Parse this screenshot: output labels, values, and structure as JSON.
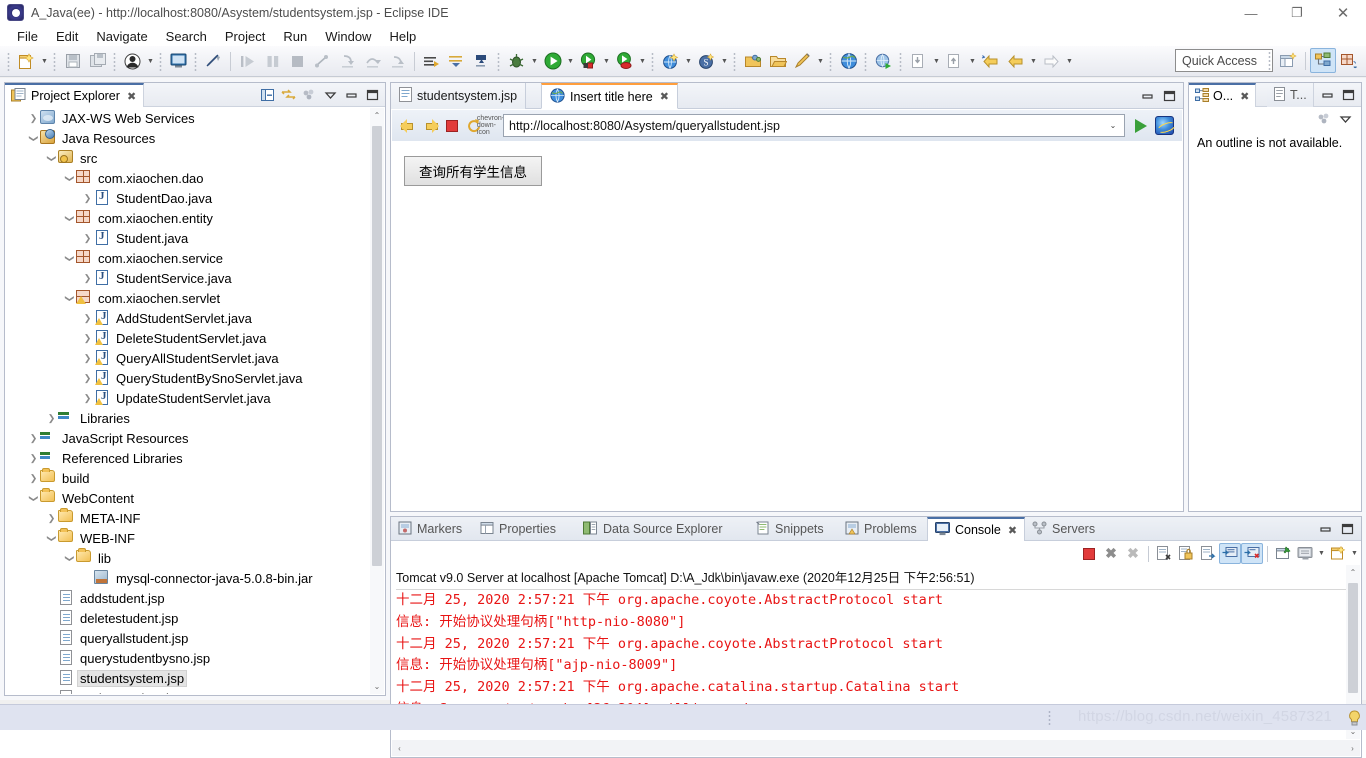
{
  "window": {
    "title": "A_Java(ee) - http://localhost:8080/Asystem/studentsystem.jsp - Eclipse IDE",
    "minimize": "—",
    "maximize": "❐",
    "close": "✕"
  },
  "menubar": {
    "items": [
      "File",
      "Edit",
      "Navigate",
      "Search",
      "Project",
      "Run",
      "Window",
      "Help"
    ]
  },
  "toolbar": {
    "quick_access_placeholder": "Quick Access",
    "perspective_buttons": [
      "open-perspective-icon",
      "java-ee-perspective-icon",
      "java-perspective-icon"
    ]
  },
  "project_explorer": {
    "tab_label": "Project Explorer",
    "tab_close": "✖",
    "tools": [
      "collapse-all-icon",
      "link-with-editor-icon",
      "view-menu-icon",
      "minimize-icon",
      "maximize-icon"
    ],
    "tree": [
      {
        "label": "JAX-WS Web Services",
        "indent": 1,
        "twisty": "›",
        "icon": "ic-ws",
        "selected": false
      },
      {
        "label": "Java Resources",
        "indent": 1,
        "twisty": "⌄",
        "icon": "ic-jres",
        "selected": false
      },
      {
        "label": "src",
        "indent": 2,
        "twisty": "⌄",
        "icon": "ic-src",
        "selected": false
      },
      {
        "label": "com.xiaochen.dao",
        "indent": 3,
        "twisty": "⌄",
        "icon": "ic-pkg",
        "selected": false
      },
      {
        "label": "StudentDao.java",
        "indent": 4,
        "twisty": "›",
        "icon": "ic-java",
        "selected": false
      },
      {
        "label": "com.xiaochen.entity",
        "indent": 3,
        "twisty": "⌄",
        "icon": "ic-pkg",
        "selected": false
      },
      {
        "label": "Student.java",
        "indent": 4,
        "twisty": "›",
        "icon": "ic-java",
        "selected": false
      },
      {
        "label": "com.xiaochen.service",
        "indent": 3,
        "twisty": "⌄",
        "icon": "ic-pkg",
        "selected": false
      },
      {
        "label": "StudentService.java",
        "indent": 4,
        "twisty": "›",
        "icon": "ic-java",
        "selected": false
      },
      {
        "label": "com.xiaochen.servlet",
        "indent": 3,
        "twisty": "⌄",
        "icon": "ic-pkgw",
        "selected": false
      },
      {
        "label": "AddStudentServlet.java",
        "indent": 4,
        "twisty": "›",
        "icon": "ic-javaw",
        "selected": false
      },
      {
        "label": "DeleteStudentServlet.java",
        "indent": 4,
        "twisty": "›",
        "icon": "ic-javaw",
        "selected": false
      },
      {
        "label": "QueryAllStudentServlet.java",
        "indent": 4,
        "twisty": "›",
        "icon": "ic-javaw",
        "selected": false
      },
      {
        "label": "QueryStudentBySnoServlet.java",
        "indent": 4,
        "twisty": "›",
        "icon": "ic-javaw",
        "selected": false
      },
      {
        "label": "UpdateStudentServlet.java",
        "indent": 4,
        "twisty": "›",
        "icon": "ic-javaw",
        "selected": false
      },
      {
        "label": "Libraries",
        "indent": 2,
        "twisty": "›",
        "icon": "ic-lib",
        "selected": false
      },
      {
        "label": "JavaScript Resources",
        "indent": 1,
        "twisty": "›",
        "icon": "ic-libw",
        "selected": false
      },
      {
        "label": "Referenced Libraries",
        "indent": 1,
        "twisty": "›",
        "icon": "ic-libw",
        "selected": false
      },
      {
        "label": "build",
        "indent": 1,
        "twisty": "›",
        "icon": "ic-folder",
        "selected": false
      },
      {
        "label": "WebContent",
        "indent": 1,
        "twisty": "⌄",
        "icon": "ic-folder",
        "selected": false
      },
      {
        "label": "META-INF",
        "indent": 2,
        "twisty": "›",
        "icon": "ic-folder",
        "selected": false
      },
      {
        "label": "WEB-INF",
        "indent": 2,
        "twisty": "⌄",
        "icon": "ic-folder",
        "selected": false
      },
      {
        "label": "lib",
        "indent": 3,
        "twisty": "⌄",
        "icon": "ic-folder",
        "selected": false
      },
      {
        "label": "mysql-connector-java-5.0.8-bin.jar",
        "indent": 4,
        "twisty": "",
        "icon": "ic-jar",
        "selected": false
      },
      {
        "label": "addstudent.jsp",
        "indent": 2,
        "twisty": "",
        "icon": "ic-jsp",
        "selected": false
      },
      {
        "label": "deletestudent.jsp",
        "indent": 2,
        "twisty": "",
        "icon": "ic-jsp",
        "selected": false
      },
      {
        "label": "queryallstudent.jsp",
        "indent": 2,
        "twisty": "",
        "icon": "ic-jsp",
        "selected": false
      },
      {
        "label": "querystudentbysno.jsp",
        "indent": 2,
        "twisty": "",
        "icon": "ic-jsp",
        "selected": false
      },
      {
        "label": "studentsystem.jsp",
        "indent": 2,
        "twisty": "",
        "icon": "ic-jsp",
        "selected": true
      },
      {
        "label": "updatestudent.jsp",
        "indent": 2,
        "twisty": "",
        "icon": "ic-jsp",
        "selected": false
      }
    ],
    "scroll_up": "⌃",
    "scroll_down": "⌄"
  },
  "editor": {
    "tabs": [
      {
        "label": "studentsystem.jsp",
        "active": false,
        "icon": "jsp-file-icon",
        "close": ""
      },
      {
        "label": "Insert title here",
        "active": true,
        "icon": "web-browser-icon",
        "close": "✖"
      }
    ],
    "minimize": "▁",
    "maximize": "❐",
    "browser": {
      "back_icon": "back-arrow-icon",
      "forward_icon": "forward-arrow-icon",
      "stop_icon": "stop-icon",
      "refresh_icon": "refresh-icon",
      "dropdown_icon": "chevron-down-icon",
      "url": "http://localhost:8080/Asystem/queryallstudent.jsp",
      "url_dropdown": "⌄",
      "go_icon": "go-play-icon",
      "external_browser_icon": "internet-explorer-icon",
      "page_button_label": "查询所有学生信息"
    }
  },
  "outline": {
    "tabs": [
      {
        "label": "O...",
        "active": true,
        "close": "✖",
        "icon": "outline-icon"
      },
      {
        "label": "T...",
        "active": false,
        "close": "",
        "icon": "task-list-icon"
      }
    ],
    "minimize": "▁",
    "maximize": "❐",
    "tools": [
      "view-menu-icon",
      "collapse-icon"
    ],
    "message": "An outline is not available."
  },
  "bottom_panel": {
    "tabs": [
      {
        "label": "Markers",
        "active": false,
        "icon": "markers-icon",
        "close": ""
      },
      {
        "label": "Properties",
        "active": false,
        "icon": "properties-icon",
        "close": ""
      },
      {
        "label": "Data Source Explorer",
        "active": false,
        "icon": "data-source-icon",
        "close": ""
      },
      {
        "label": "Snippets",
        "active": false,
        "icon": "snippets-icon",
        "close": ""
      },
      {
        "label": "Problems",
        "active": false,
        "icon": "problems-icon",
        "close": ""
      },
      {
        "label": "Console",
        "active": true,
        "icon": "console-icon",
        "close": "✖"
      },
      {
        "label": "Servers",
        "active": false,
        "icon": "servers-icon",
        "close": ""
      }
    ],
    "minimize": "▁",
    "maximize": "❐",
    "tools": [
      {
        "name": "terminate-icon",
        "toggled": false
      },
      {
        "name": "remove-launch-icon",
        "toggled": false
      },
      {
        "name": "remove-all-terminated-icon",
        "toggled": false
      },
      {
        "name": "clear-console-icon",
        "toggled": false
      },
      {
        "name": "scroll-lock-icon",
        "toggled": false
      },
      {
        "name": "word-wrap-icon",
        "toggled": false
      },
      {
        "name": "show-console-on-output-icon",
        "toggled": true
      },
      {
        "name": "show-console-on-error-icon",
        "toggled": true
      },
      {
        "name": "pin-console-icon",
        "toggled": false
      },
      {
        "name": "display-selected-console-icon",
        "toggled": false
      },
      {
        "name": "open-console-icon",
        "toggled": false
      }
    ],
    "console": {
      "header": "Tomcat v9.0 Server at localhost [Apache Tomcat] D:\\A_Jdk\\bin\\javaw.exe (2020年12月25日 下午2:56:51)",
      "lines": [
        "十二月 25, 2020 2:57:21 下午 org.apache.coyote.AbstractProtocol start",
        "信息: 开始协议处理句柄[\"http-nio-8080\"]",
        "十二月 25, 2020 2:57:21 下午 org.apache.coyote.AbstractProtocol start",
        "信息: 开始协议处理句柄[\"ajp-nio-8009\"]",
        "十二月 25, 2020 2:57:21 下午 org.apache.catalina.startup.Catalina start",
        "信息: Server startup in [26,204] milliseconds"
      ],
      "text_color": "#e81414",
      "scroll_left": "‹",
      "scroll_right": "›",
      "scroll_up": "⌃",
      "scroll_down": "⌄"
    }
  },
  "statusbar": {
    "watermark": "https://blog.csdn.net/weixin_4587321"
  }
}
